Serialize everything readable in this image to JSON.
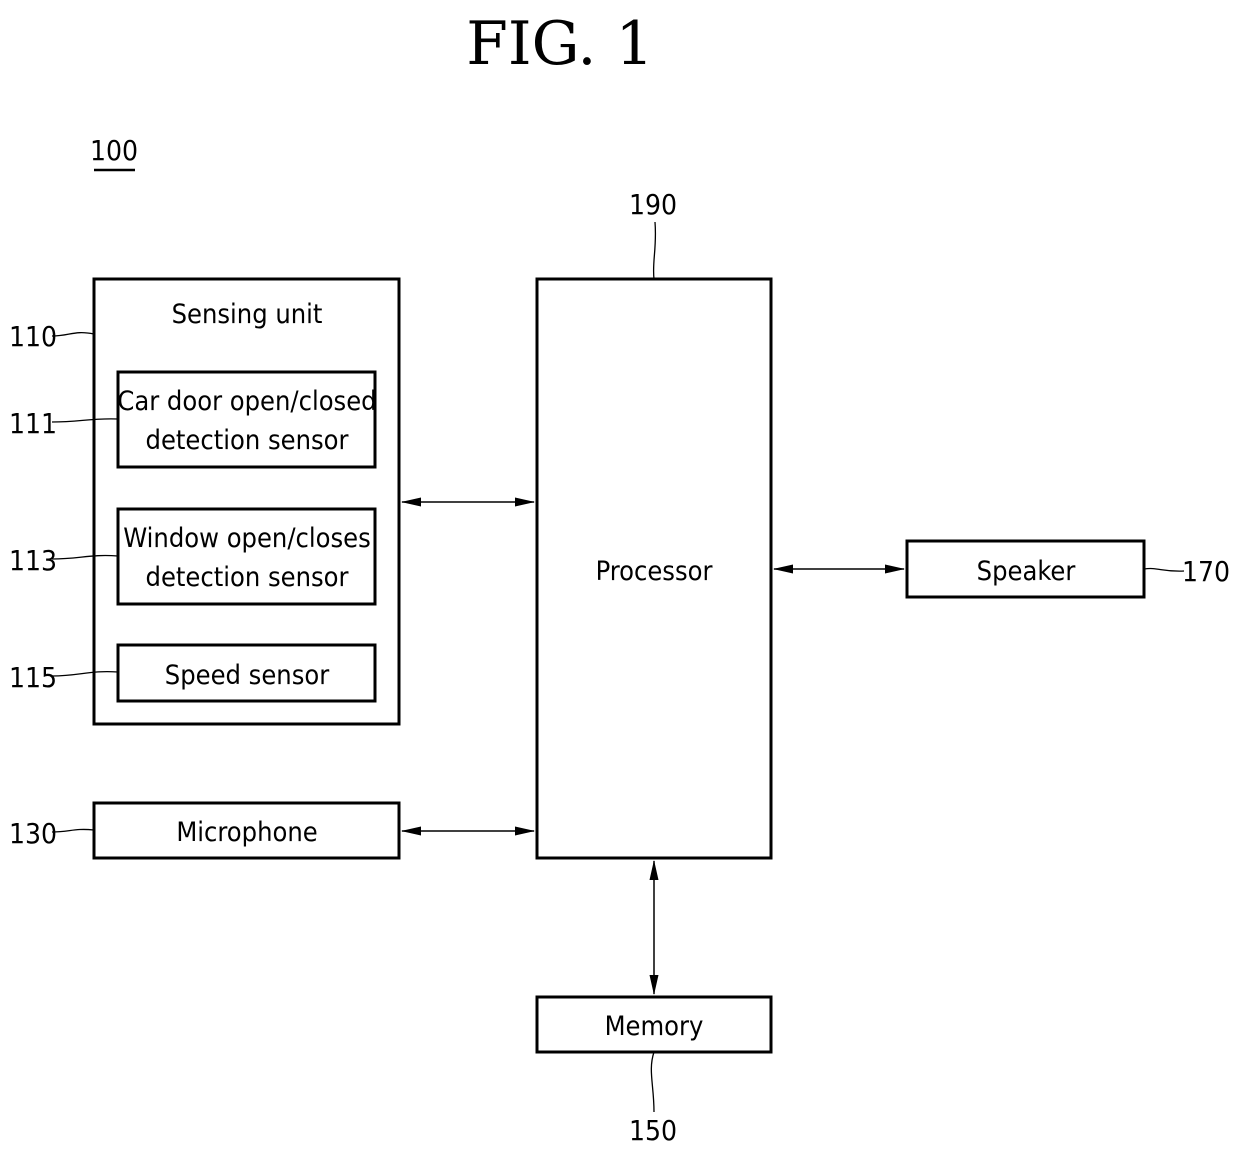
{
  "figure": {
    "title": "FIG. 1",
    "system_ref": "100"
  },
  "blocks": {
    "sensing_unit": {
      "label": "Sensing unit",
      "ref": "110"
    },
    "door_sensor": {
      "label_line1": "Car door open/closed",
      "label_line2": "detection sensor",
      "ref": "111"
    },
    "window_sensor": {
      "label_line1": "Window open/closes",
      "label_line2": "detection sensor",
      "ref": "113"
    },
    "speed_sensor": {
      "label": "Speed sensor",
      "ref": "115"
    },
    "microphone": {
      "label": "Microphone",
      "ref": "130"
    },
    "memory": {
      "label": "Memory",
      "ref": "150"
    },
    "speaker": {
      "label": "Speaker",
      "ref": "170"
    },
    "processor": {
      "label": "Processor",
      "ref": "190"
    }
  },
  "connections": [
    {
      "from": "sensing_unit",
      "to": "processor",
      "direction": "bidirectional"
    },
    {
      "from": "microphone",
      "to": "processor",
      "direction": "bidirectional"
    },
    {
      "from": "processor",
      "to": "speaker",
      "direction": "bidirectional"
    },
    {
      "from": "processor",
      "to": "memory",
      "direction": "bidirectional"
    }
  ]
}
